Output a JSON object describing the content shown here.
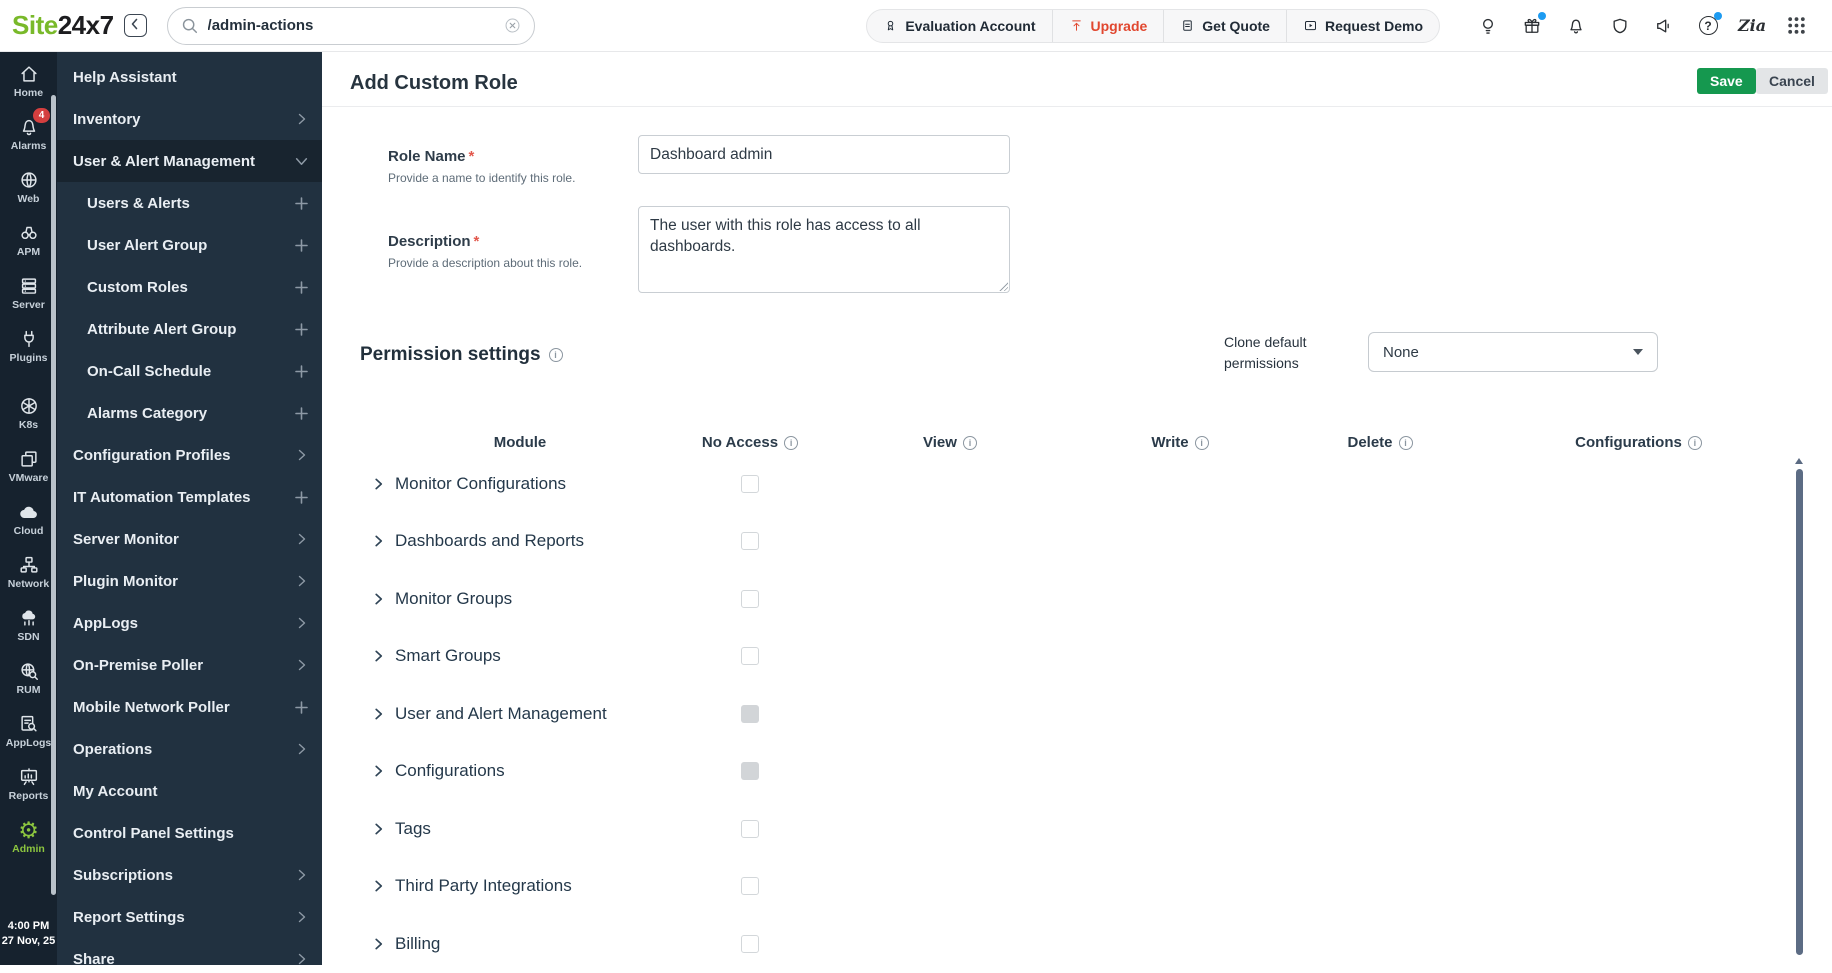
{
  "topbar": {
    "logo_site": "Site",
    "logo_suffix": "24x7",
    "search": {
      "value": "/admin-actions"
    },
    "pills": [
      {
        "label": "Evaluation Account",
        "icon": "evaluation-medal-icon"
      },
      {
        "label": "Upgrade",
        "icon": "upgrade-arrow-icon",
        "variant": "accent"
      },
      {
        "label": "Get Quote",
        "icon": "quote-document-icon"
      },
      {
        "label": "Request Demo",
        "icon": "demo-play-icon"
      }
    ],
    "icons": [
      {
        "icon": "idea-bulb-icon"
      },
      {
        "icon": "gift-icon",
        "dot": true
      },
      {
        "icon": "notification-bell-icon"
      },
      {
        "icon": "shield-icon"
      },
      {
        "icon": "announcement-megaphone-icon"
      },
      {
        "icon": "help-question-icon",
        "dot": true
      },
      {
        "icon": "zia-assistant-icon"
      },
      {
        "icon": "apps-grid-icon"
      }
    ]
  },
  "rail": {
    "items": [
      {
        "label": "Home",
        "icon": "home-icon"
      },
      {
        "label": "Alarms",
        "icon": "alarm-bell-icon",
        "badge": "4"
      },
      {
        "label": "Web",
        "icon": "web-globe-icon"
      },
      {
        "label": "APM",
        "icon": "apm-binoculars-icon"
      },
      {
        "label": "Server",
        "icon": "server-stack-icon"
      },
      {
        "label": "Plugins",
        "icon": "plugins-plug-icon"
      },
      {
        "label": "K8s",
        "icon": "kubernetes-icon"
      },
      {
        "label": "VMware",
        "icon": "vmware-layers-icon"
      },
      {
        "label": "Cloud",
        "icon": "cloud-icon"
      },
      {
        "label": "Network",
        "icon": "network-topology-icon"
      },
      {
        "label": "SDN",
        "icon": "sdn-cloud-icon"
      },
      {
        "label": "RUM",
        "icon": "rum-globe-search-icon"
      },
      {
        "label": "AppLogs",
        "icon": "applogs-doc-search-icon"
      },
      {
        "label": "Reports",
        "icon": "reports-board-icon"
      },
      {
        "label": "Admin",
        "icon": "admin-gear-icon",
        "variant": "active"
      }
    ],
    "clock": {
      "time": "4:00 PM",
      "date": "27 Nov, 25"
    }
  },
  "sidebar": {
    "items": [
      {
        "label": "Help Assistant"
      },
      {
        "label": "Inventory",
        "right_icon": "chevron-right-icon"
      },
      {
        "label": "User & Alert Management",
        "variant": "section-open",
        "right_icon": "chevron-down-icon"
      },
      {
        "label": "Users & Alerts",
        "variant": "sub",
        "right_icon": "plus-icon"
      },
      {
        "label": "User Alert Group",
        "variant": "sub",
        "right_icon": "plus-icon"
      },
      {
        "label": "Custom Roles",
        "variant": "sub active",
        "right_icon": "plus-icon"
      },
      {
        "label": "Attribute Alert Group",
        "variant": "sub",
        "right_icon": "plus-icon"
      },
      {
        "label": "On-Call Schedule",
        "variant": "sub",
        "right_icon": "plus-icon"
      },
      {
        "label": "Alarms Category",
        "variant": "sub",
        "right_icon": "plus-icon"
      },
      {
        "label": "Configuration Profiles",
        "right_icon": "chevron-right-icon"
      },
      {
        "label": "IT Automation Templates",
        "right_icon": "plus-icon"
      },
      {
        "label": "Server Monitor",
        "right_icon": "chevron-right-icon"
      },
      {
        "label": "Plugin Monitor",
        "right_icon": "chevron-right-icon"
      },
      {
        "label": "AppLogs",
        "right_icon": "chevron-right-icon"
      },
      {
        "label": "On-Premise Poller",
        "right_icon": "chevron-right-icon"
      },
      {
        "label": "Mobile Network Poller",
        "right_icon": "plus-icon"
      },
      {
        "label": "Operations",
        "right_icon": "chevron-right-icon"
      },
      {
        "label": "My Account"
      },
      {
        "label": "Control Panel Settings"
      },
      {
        "label": "Subscriptions",
        "right_icon": "chevron-right-icon"
      },
      {
        "label": "Report Settings",
        "right_icon": "chevron-right-icon"
      },
      {
        "label": "Share",
        "right_icon": "chevron-right-icon"
      }
    ]
  },
  "main": {
    "title": "Add Custom Role",
    "save_label": "Save",
    "cancel_label": "Cancel",
    "form": {
      "role_name": {
        "label": "Role Name",
        "required": "*",
        "help": "Provide a name to identify this role.",
        "value": "Dashboard admin"
      },
      "description": {
        "label": "Description",
        "required": "*",
        "help": "Provide a description about this role.",
        "value": "The user with this role has access to all dashboards."
      }
    },
    "permissions": {
      "heading": "Permission settings",
      "clone_label": "Clone default permissions",
      "clone_value": "None",
      "columns": [
        {
          "label": "Module"
        },
        {
          "label": "No Access",
          "info": true
        },
        {
          "label": "View",
          "info": true
        },
        {
          "label": "Write",
          "info": true
        },
        {
          "label": "Delete",
          "info": true
        },
        {
          "label": "Configurations",
          "info": true
        }
      ],
      "rows": [
        {
          "label": "Monitor Configurations",
          "no_access": "unchecked"
        },
        {
          "label": "Dashboards and Reports",
          "no_access": "unchecked"
        },
        {
          "label": "Monitor Groups",
          "no_access": "unchecked"
        },
        {
          "label": "Smart Groups",
          "no_access": "unchecked"
        },
        {
          "label": "User and Alert Management",
          "no_access": "indeterminate"
        },
        {
          "label": "Configurations",
          "no_access": "indeterminate"
        },
        {
          "label": "Tags",
          "no_access": "unchecked"
        },
        {
          "label": "Third Party Integrations",
          "no_access": "unchecked"
        },
        {
          "label": "Billing",
          "no_access": "unchecked"
        }
      ]
    }
  },
  "colors": {
    "brand_green": "#79b92a",
    "save_green": "#15984f",
    "upgrade_red": "#e1472f",
    "alarm_badge_red": "#d43f3f",
    "notification_dot_blue": "#1d9bf1",
    "admin_active_green": "#8cc63f",
    "rail_bg": "#16222e",
    "sidebar_bg": "#213140"
  }
}
